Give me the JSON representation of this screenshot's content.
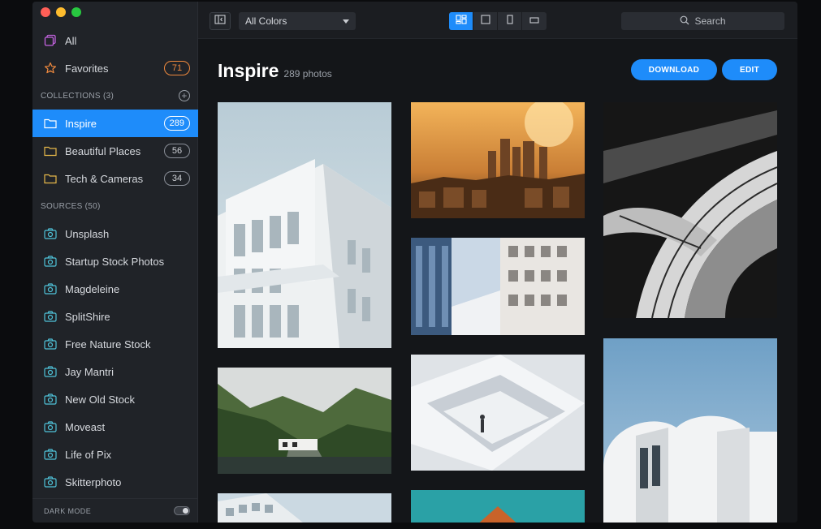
{
  "sidebar": {
    "top_items": [
      {
        "label": "All",
        "icon": "all-icon"
      },
      {
        "label": "Favorites",
        "icon": "star-icon",
        "count": "71"
      }
    ],
    "collections_header": "COLLECTIONS (3)",
    "collections": [
      {
        "label": "Inspire",
        "count": "289",
        "active": true
      },
      {
        "label": "Beautiful Places",
        "count": "56"
      },
      {
        "label": "Tech & Cameras",
        "count": "34"
      }
    ],
    "sources_header": "SOURCES (50)",
    "sources": [
      "Unsplash",
      "Startup Stock Photos",
      "Magdeleine",
      "SplitShire",
      "Free Nature Stock",
      "Jay Mantri",
      "New Old Stock",
      "Moveast",
      "Life of Pix",
      "Skitterphoto"
    ],
    "dark_mode_label": "DARK MODE",
    "dark_mode_on": true
  },
  "toolbar": {
    "color_filter": "All Colors",
    "search_placeholder": "Search",
    "active_view": "masonry"
  },
  "main": {
    "title": "Inspire",
    "subtitle": "289 photos",
    "download_label": "DOWNLOAD",
    "edit_label": "EDIT"
  },
  "colors": {
    "accent": "#1e8cfa",
    "favorites_badge": "#f08a3e"
  }
}
